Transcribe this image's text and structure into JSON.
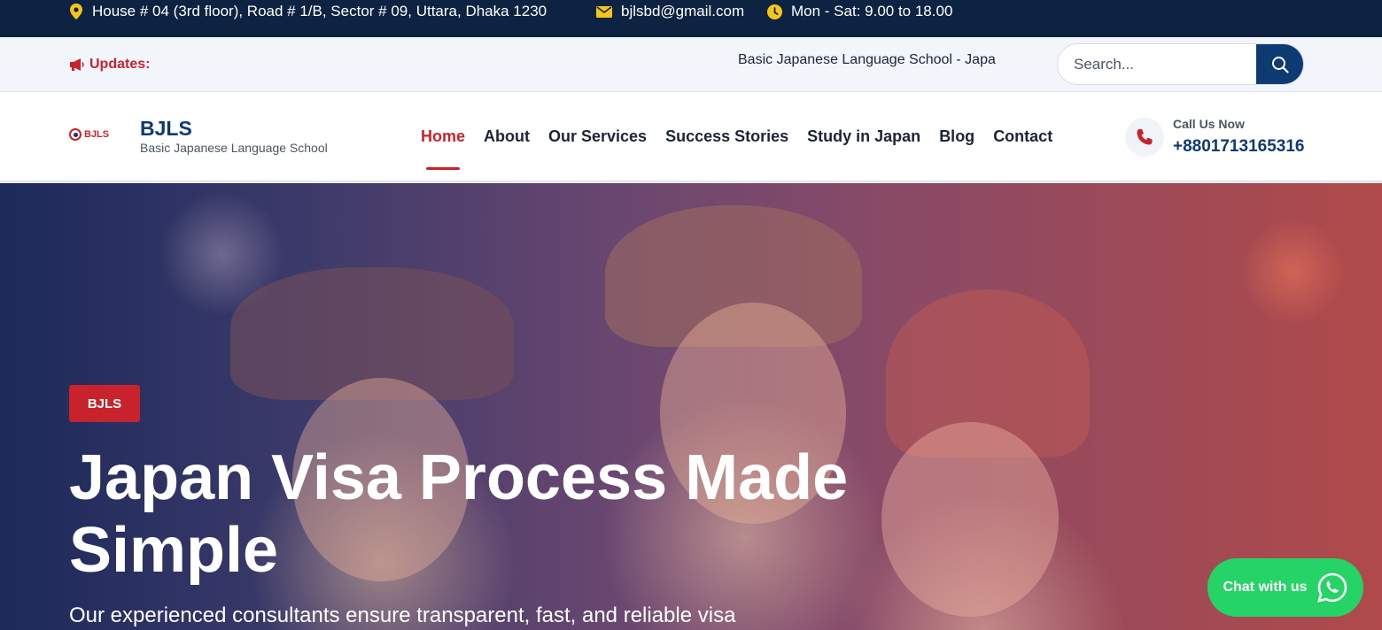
{
  "topbar": {
    "address": "House # 04 (3rd floor), Road # 1/B, Sector # 09, Uttara, Dhaka 1230",
    "email": "bjlsbd@gmail.com",
    "hours": "Mon - Sat: 9.00 to 18.00"
  },
  "updates": {
    "label": "Updates:",
    "ticker": "Basic Japanese Language School - Japa"
  },
  "search": {
    "placeholder": "Search..."
  },
  "brand": {
    "logo_text": "BJLS",
    "name": "BJLS",
    "subtitle": "Basic Japanese Language School"
  },
  "nav": {
    "items": [
      {
        "label": "Home",
        "active": true
      },
      {
        "label": "About"
      },
      {
        "label": "Our Services"
      },
      {
        "label": "Success Stories"
      },
      {
        "label": "Study in Japan"
      },
      {
        "label": "Blog"
      },
      {
        "label": "Contact"
      }
    ]
  },
  "call": {
    "label": "Call Us Now",
    "number": "+8801713165316"
  },
  "hero": {
    "badge": "BJLS",
    "title": "Japan Visa Process Made Simple",
    "text": "Our experienced consultants ensure transparent, fast, and reliable visa"
  },
  "chat": {
    "label": "Chat with us"
  },
  "colors": {
    "navy": "#0e2341",
    "brand_blue": "#0e3a73",
    "accent_red": "#c8232c",
    "whatsapp_green": "#25d366",
    "icon_yellow": "#f5c518"
  }
}
